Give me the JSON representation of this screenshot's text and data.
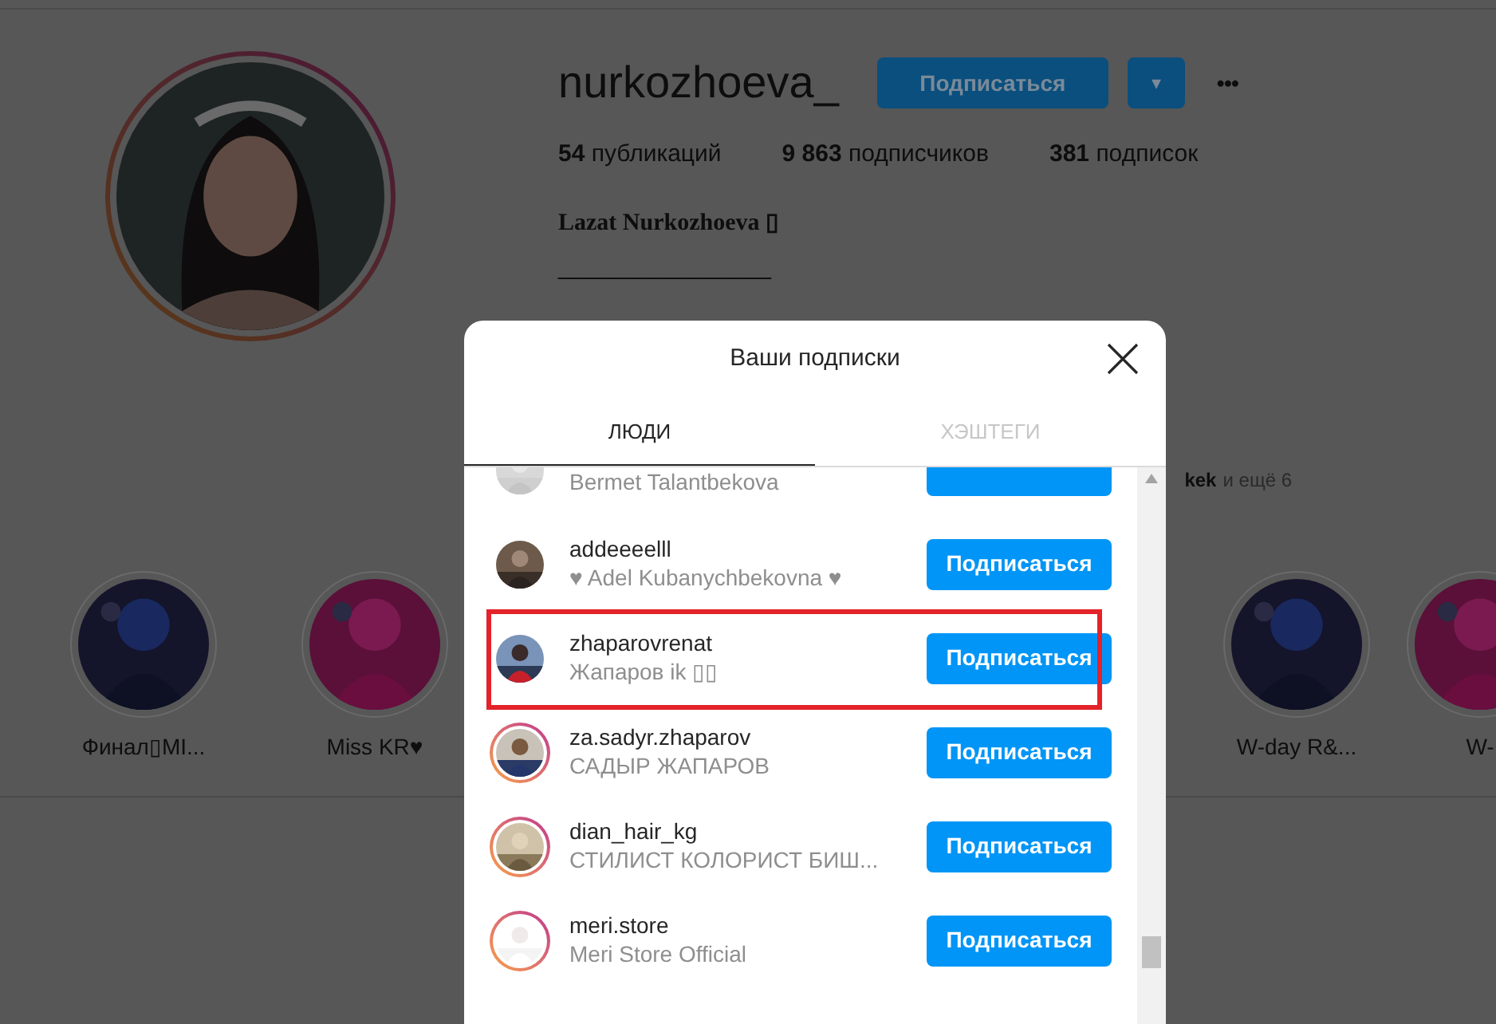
{
  "profile": {
    "username": "nurkozhoeva_",
    "follow_button": "Подписаться",
    "dropdown_icon": "▾",
    "more_icon": "•••",
    "stats": [
      {
        "count": "54",
        "label": "публикаций"
      },
      {
        "count": "9 863",
        "label": "подписчиков"
      },
      {
        "count": "381",
        "label": "подписок"
      }
    ],
    "full_name": "Lazat Nurkozhoeva ▯",
    "bio_line": "________________",
    "followed_by": {
      "name": "kek",
      "rest": "и ещё 6"
    }
  },
  "highlights_left": [
    {
      "label": "Финал▯MI..."
    },
    {
      "label": "Miss KR♥"
    }
  ],
  "highlights_right": [
    {
      "label": "W-day R&..."
    },
    {
      "label": "W-"
    }
  ],
  "modal": {
    "title": "Ваши подписки",
    "tabs": [
      {
        "label": "ЛЮДИ",
        "selected": true
      },
      {
        "label": "ХЭШТЕГИ",
        "selected": false
      }
    ],
    "rows": [
      {
        "kind": "clipped",
        "full_name": "Bermet Talantbekova",
        "story": false,
        "highlighted": false
      },
      {
        "kind": "full",
        "username": "addeeeelll",
        "full_name": "♥ Adel Kubanychbekovna ♥",
        "button": "Подписаться",
        "story": false,
        "highlighted": false
      },
      {
        "kind": "full",
        "username": "zhaparovrenat",
        "full_name": "Жапаров ik ▯▯",
        "button": "Подписаться",
        "story": false,
        "highlighted": true
      },
      {
        "kind": "full",
        "username": "za.sadyr.zhaparov",
        "full_name": "САДЫР ЖАПАРОВ",
        "button": "Подписаться",
        "story": true,
        "highlighted": false
      },
      {
        "kind": "full",
        "username": "dian_hair_kg",
        "full_name": "СТИЛИСТ КОЛОРИСТ БИШ...",
        "button": "Подписаться",
        "story": true,
        "highlighted": false
      },
      {
        "kind": "full",
        "username": "meri.store",
        "full_name": "Meri Store Official",
        "button": "Подписаться",
        "story": true,
        "highlighted": false
      }
    ]
  }
}
